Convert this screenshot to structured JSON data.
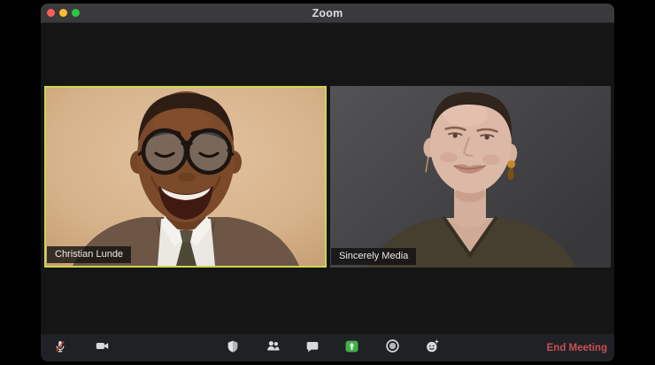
{
  "window": {
    "title": "Zoom"
  },
  "titlebar": {
    "traffic_lights": [
      {
        "name": "close",
        "color": "#ff5f57"
      },
      {
        "name": "minimize",
        "color": "#febc2e"
      },
      {
        "name": "zoom",
        "color": "#2ac840"
      }
    ]
  },
  "participants": [
    {
      "name": "Christian Lunde",
      "active_speaker": true
    },
    {
      "name": "Sincerely Media",
      "active_speaker": false
    }
  ],
  "toolbar": {
    "icons": [
      "microphone-muted-icon",
      "video-camera-icon",
      "security-shield-icon",
      "participants-icon",
      "chat-icon",
      "share-screen-icon",
      "record-icon",
      "reactions-icon"
    ],
    "end_meeting_label": "End Meeting"
  },
  "colors": {
    "active_speaker_border": "#ccd74f",
    "end_meeting_text": "#c75055",
    "share_button": "#41b049",
    "mute_slash": "#c0392b"
  }
}
